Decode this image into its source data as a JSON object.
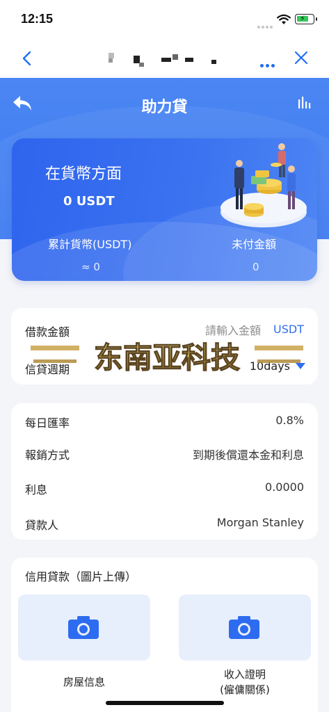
{
  "status_bar": {
    "time": "12:15"
  },
  "web_nav": {
    "more_icon": "more-dots-icon",
    "close_icon": "close-icon",
    "back_icon": "chevron-left-icon"
  },
  "header": {
    "title": "助力貸",
    "back_icon": "back-arrow-icon",
    "stats_icon": "bar-chart-icon"
  },
  "summary": {
    "title": "在貨幣方面",
    "amount": "0 USDT",
    "cumulative_label": "累計貨幣(USDT)",
    "cumulative_value": "≈ 0",
    "unpaid_label": "未付金額",
    "unpaid_value": "0"
  },
  "loan_form": {
    "amount_label": "借款金額",
    "amount_placeholder": "請輸入金額",
    "amount_unit": "USDT",
    "period_label": "信貸週期",
    "period_value": "10days"
  },
  "watermark": {
    "text": "东南亚科技"
  },
  "info": {
    "rows": [
      {
        "label": "每日匯率",
        "value": "0.8%"
      },
      {
        "label": "報銷方式",
        "value": "到期後償還本金和利息"
      },
      {
        "label": "利息",
        "value": "0.0000"
      },
      {
        "label": "貸款人",
        "value": "Morgan Stanley"
      }
    ]
  },
  "upload": {
    "title": "信用貸款（圖片上傳）",
    "items": [
      {
        "caption": "房屋信息"
      },
      {
        "caption_line1": "收入證明",
        "caption_line2": "(僱傭關係)"
      }
    ]
  },
  "colors": {
    "primary": "#3e7bf1",
    "accent": "#2f6ef0",
    "background": "#f4f5f9"
  }
}
